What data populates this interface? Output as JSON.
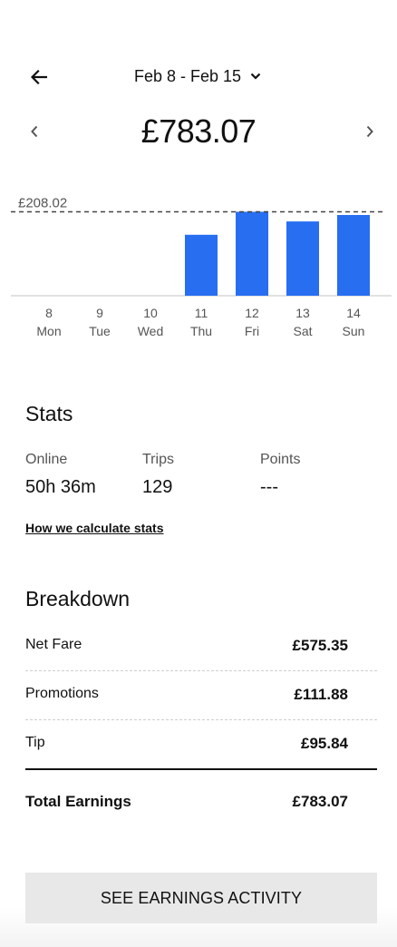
{
  "header": {
    "date_range": "Feb 8 - Feb 15",
    "total": "£783.07"
  },
  "chart_data": {
    "type": "bar",
    "categories": [
      "8",
      "9",
      "10",
      "11",
      "12",
      "13",
      "14"
    ],
    "day_labels": [
      "Mon",
      "Tue",
      "Wed",
      "Thu",
      "Fri",
      "Sat",
      "Sun"
    ],
    "values": [
      0,
      0,
      0,
      151.0,
      208.02,
      184.0,
      200.0
    ],
    "reference_line": {
      "value": 208.02,
      "label": "£208.02"
    },
    "ylim": [
      0,
      218
    ],
    "bar_color": "#276ef1",
    "title": "",
    "xlabel": "",
    "ylabel": ""
  },
  "stats": {
    "title": "Stats",
    "items": [
      {
        "label": "Online",
        "value": "50h 36m"
      },
      {
        "label": "Trips",
        "value": "129"
      },
      {
        "label": "Points",
        "value": "---"
      }
    ],
    "link": "How we calculate stats"
  },
  "breakdown": {
    "title": "Breakdown",
    "rows": [
      {
        "label": "Net Fare",
        "value": "£575.35"
      },
      {
        "label": "Promotions",
        "value": "£111.88"
      },
      {
        "label": "Tip",
        "value": "£95.84"
      }
    ],
    "total": {
      "label": "Total Earnings",
      "value": "£783.07"
    }
  },
  "actions": {
    "activity_button": "SEE EARNINGS ACTIVITY"
  },
  "icons": {
    "back": "arrow-left-icon",
    "dropdown": "chevron-down-icon",
    "prev": "chevron-left-icon",
    "next": "chevron-right-icon"
  }
}
